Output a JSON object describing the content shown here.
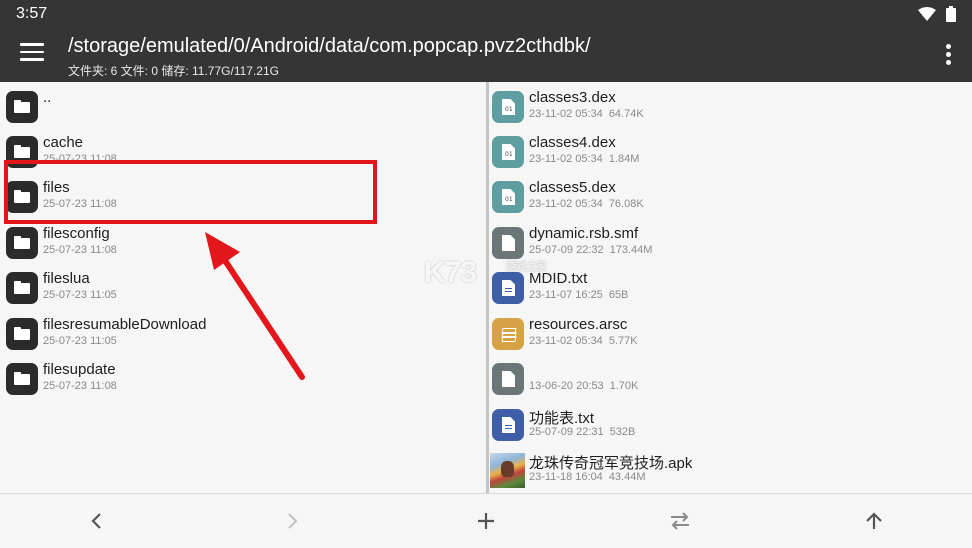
{
  "status": {
    "time": "3:57"
  },
  "header": {
    "path": "/storage/emulated/0/Android/data/com.popcap.pvz2cthdbk/",
    "stats": "文件夹: 6  文件: 0  储存: 11.77G/117.21G"
  },
  "left_pane": {
    "items": [
      {
        "name": "..",
        "meta": ""
      },
      {
        "name": "cache",
        "meta": "25-07-23 11:08"
      },
      {
        "name": "files",
        "meta": "25-07-23 11:08"
      },
      {
        "name": "filesconfig",
        "meta": "25-07-23 11:08"
      },
      {
        "name": "fileslua",
        "meta": "25-07-23 11:05"
      },
      {
        "name": "filesresumableDownload",
        "meta": "25-07-23 11:05"
      },
      {
        "name": "filesupdate",
        "meta": "25-07-23 11:08"
      }
    ]
  },
  "right_pane": {
    "items": [
      {
        "name": "classes3.dex",
        "date": "23-11-02 05:34",
        "size": "64.74K",
        "icon": "dex-file-icon"
      },
      {
        "name": "classes4.dex",
        "date": "23-11-02 05:34",
        "size": "1.84M",
        "icon": "dex-file-icon"
      },
      {
        "name": "classes5.dex",
        "date": "23-11-02 05:34",
        "size": "76.08K",
        "icon": "dex-file-icon"
      },
      {
        "name": "dynamic.rsb.smf",
        "date": "25-07-09 22:32",
        "size": "173.44M",
        "icon": "generic-file-icon"
      },
      {
        "name": "MDID.txt",
        "date": "23-11-07 16:25",
        "size": "65B",
        "icon": "text-file-icon"
      },
      {
        "name": "resources.arsc",
        "date": "23-11-02 05:34",
        "size": "5.77K",
        "icon": "layers-icon"
      },
      {
        "name": "",
        "date": "13-06-20 20:53",
        "size": "1.70K",
        "icon": "generic-file-icon"
      },
      {
        "name": "功能表.txt",
        "date": "25-07-09 22:31",
        "size": "532B",
        "icon": "text-file-icon"
      },
      {
        "name": "龙珠传奇冠军竞技场.apk",
        "date": "23-11-18 16:04",
        "size": "43.44M",
        "icon": "apk-thumbnail"
      }
    ]
  },
  "watermark": {
    "text": "K73",
    "sub": "游戏之家"
  },
  "colors": {
    "bar": "#353535",
    "highlight": "#e3161b",
    "folder": "#2b2b2b",
    "dex": "#5e9ea0",
    "txt": "#3e5fa8",
    "arsc": "#d5a346"
  }
}
